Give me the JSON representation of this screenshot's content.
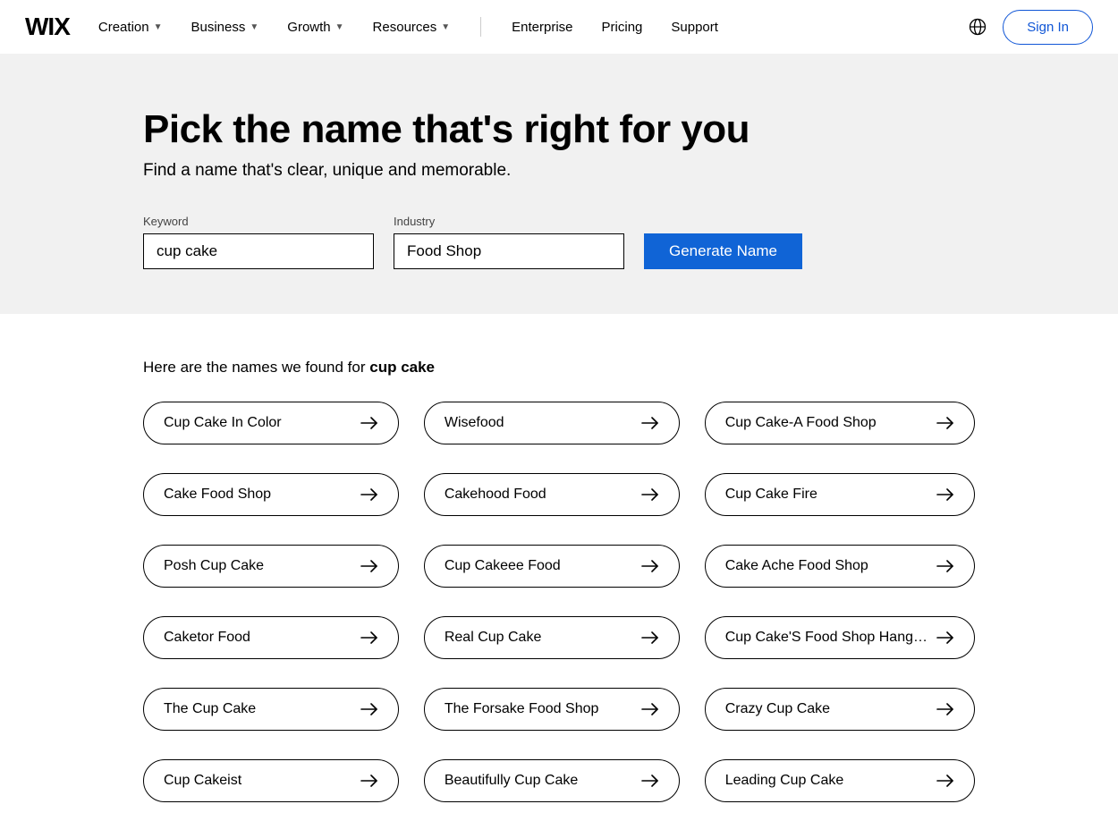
{
  "header": {
    "logo": "WIX",
    "nav_dropdowns": [
      {
        "label": "Creation"
      },
      {
        "label": "Business"
      },
      {
        "label": "Growth"
      },
      {
        "label": "Resources"
      }
    ],
    "nav_links": [
      {
        "label": "Enterprise"
      },
      {
        "label": "Pricing"
      },
      {
        "label": "Support"
      }
    ],
    "signin": "Sign In"
  },
  "hero": {
    "title": "Pick the name that's right for you",
    "subtitle": "Find a name that's clear, unique and memorable.",
    "keyword_label": "Keyword",
    "keyword_value": "cup cake",
    "industry_label": "Industry",
    "industry_value": "Food Shop",
    "generate_label": "Generate Name"
  },
  "results": {
    "intro_prefix": "Here are the names we found for ",
    "intro_keyword": "cup cake",
    "names": [
      "Cup Cake In Color",
      "Wisefood",
      "Cup Cake-A Food Shop",
      "Cake Food Shop",
      "Cakehood Food",
      "Cup Cake Fire",
      "Posh Cup Cake",
      "Cup Cakeee Food",
      "Cake Ache Food Shop",
      "Caketor Food",
      "Real Cup Cake",
      "Cup Cake'S Food Shop Hang…",
      "The Cup Cake",
      "The Forsake Food Shop",
      "Crazy Cup Cake",
      "Cup Cakeist",
      "Beautifully Cup Cake",
      "Leading Cup Cake"
    ]
  }
}
